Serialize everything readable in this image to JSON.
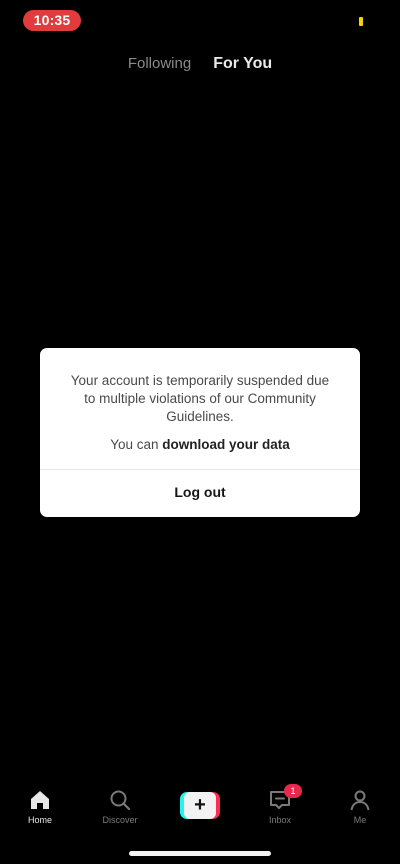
{
  "status_bar": {
    "time": "10:35"
  },
  "top_tabs": [
    {
      "label": "Following",
      "active": false
    },
    {
      "label": "For You",
      "active": true
    }
  ],
  "dialog": {
    "message": "Your account is temporarily suspended due to multiple violations of our Community Guidelines.",
    "download_prefix": "You can ",
    "download_link": "download your data",
    "logout_label": "Log out"
  },
  "bottom_nav": {
    "home_label": "Home",
    "discover_label": "Discover",
    "create_symbol": "+",
    "inbox_label": "Inbox",
    "inbox_badge": "1",
    "me_label": "Me"
  },
  "colors": {
    "background": "#000000",
    "time_pill": "#e23b3b",
    "badge": "#e5294f",
    "create_cyan": "#25f4ee",
    "create_red": "#fe2c55"
  }
}
